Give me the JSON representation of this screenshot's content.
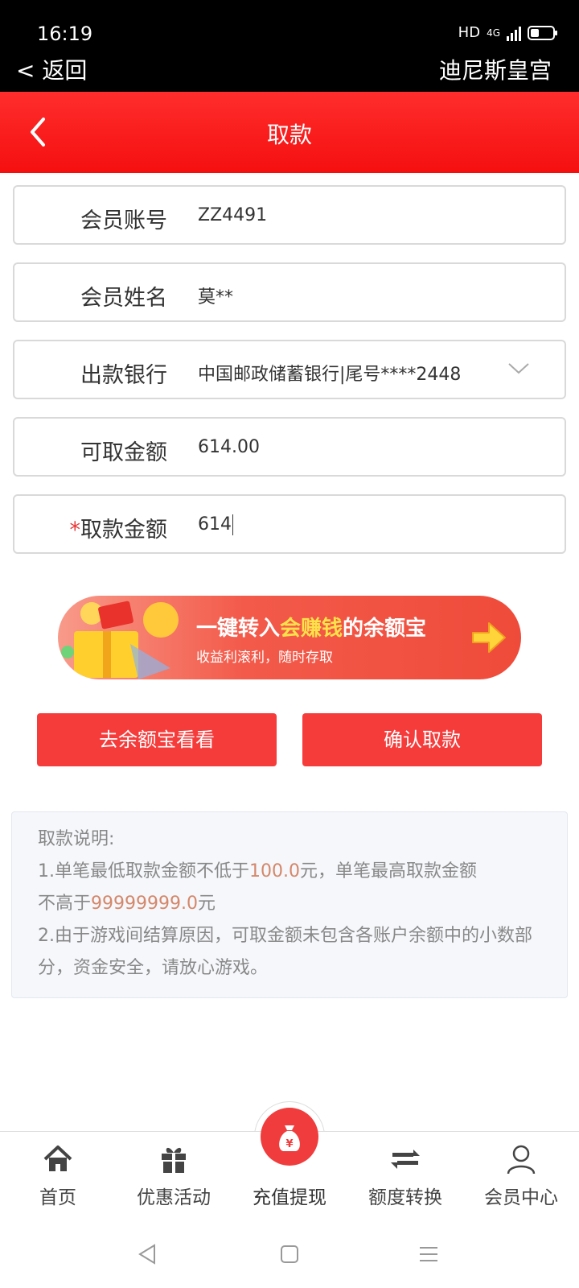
{
  "status": {
    "time": "16:19",
    "network": "HD",
    "signal_label": "4G",
    "back_label": "< 返回",
    "app_name": "迪尼斯皇宫"
  },
  "header": {
    "title": "取款"
  },
  "form": {
    "member_account": {
      "label": "会员账号",
      "value": "ZZ4491"
    },
    "member_name": {
      "label": "会员姓名",
      "value": "莫**"
    },
    "bank": {
      "label": "出款银行",
      "value": "中国邮政储蓄银行|尾号****2448"
    },
    "available": {
      "label": "可取金额",
      "value": "614.00"
    },
    "withdraw": {
      "required_mark": "*",
      "label": "取款金额",
      "value": "614"
    }
  },
  "banner": {
    "line1_pre": "一键转入",
    "line1_hl": "会赚钱",
    "line1_post": "的余额宝",
    "line2": "收益利滚利，随时存取"
  },
  "buttons": {
    "yuebao": "去余额宝看看",
    "confirm": "确认取款"
  },
  "notice": {
    "title": "取款说明:",
    "l1a": "1.单笔最低取款金额不低于",
    "min": "100.0",
    "l1b": "元，单笔最高取款金额",
    "l1c": "不高于",
    "max": "99999999.0",
    "l1d": "元",
    "l2": "2.由于游戏间结算原因，可取金额未包含各账户余额中的小数部分，资金安全，请放心游戏。"
  },
  "tabs": [
    {
      "label": "首页",
      "icon": "home-icon"
    },
    {
      "label": "优惠活动",
      "icon": "gift-icon"
    },
    {
      "label": "充值提现",
      "icon": "money-bag-icon"
    },
    {
      "label": "额度转换",
      "icon": "transfer-icon"
    },
    {
      "label": "会员中心",
      "icon": "user-icon"
    }
  ],
  "colors": {
    "brand_red": "#f63b3b",
    "header_red": "#ff2d2d",
    "highlight_number": "#d4876a"
  }
}
